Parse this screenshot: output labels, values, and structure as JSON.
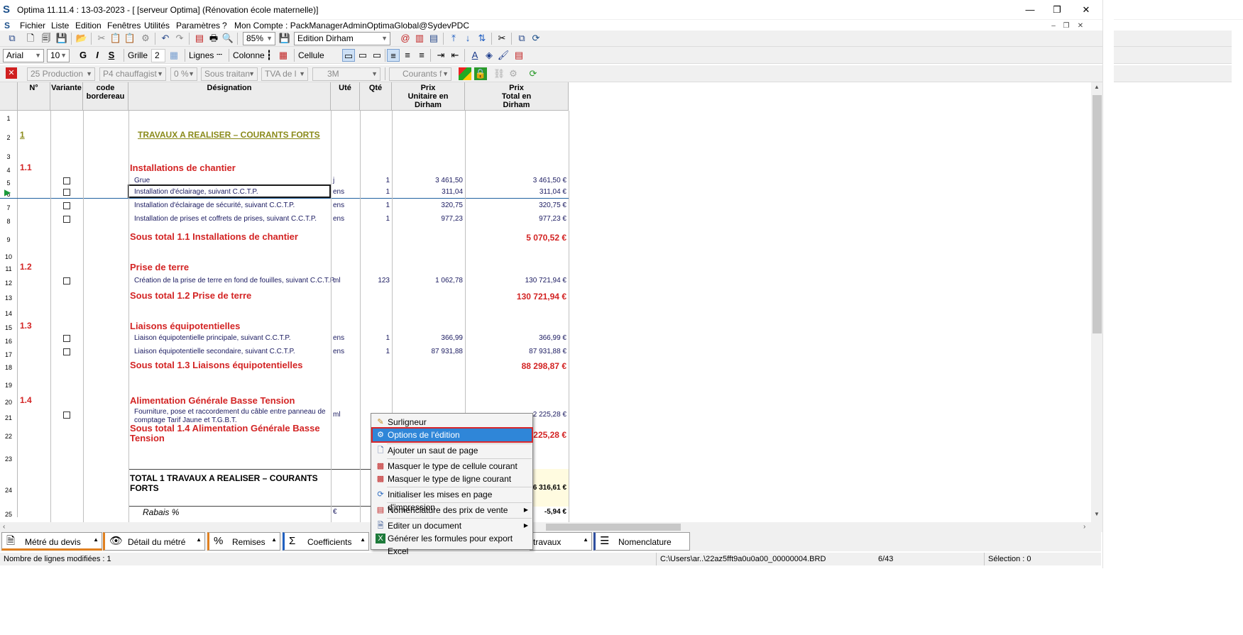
{
  "window": {
    "title": "Optima 11.11.4 : 13-03-2023 - [ [serveur Optima] (Rénovation école maternelle)]",
    "min": "—",
    "restore": "❐",
    "close": "✕"
  },
  "menu": [
    "Fichier",
    "Liste",
    "Edition",
    "Fenêtres",
    "Utilités",
    "Paramètres",
    "?",
    "Mon Compte : PackManagerAdminOptimaGlobal@SydevPDC"
  ],
  "toolbar1": {
    "zoom": "85%",
    "edition": "Edition Dirham"
  },
  "toolbar2": {
    "font": "Arial",
    "size": "10",
    "bold": "G",
    "italic": "I",
    "underline": "S",
    "grille_label": "Grille",
    "grille_value": "2",
    "lignes_label": "Lignes",
    "colonne_label": "Colonne",
    "cellule_label": "Cellule"
  },
  "toolbar3": {
    "production": "25  Production",
    "chauffage": "P4  chauffagist",
    "pct": "0 %",
    "sous_traitan": "Sous traitan",
    "tva": "TVA de l",
    "code3m": "3M",
    "courants": "Courants f"
  },
  "columns": {
    "no": "N°",
    "variante": "Variante",
    "code": "code bordereau",
    "designation": "Désignation",
    "ute": "Uté",
    "qte": "Qté",
    "pu": "Prix Unitaire en Dirham",
    "pt": "Prix Total en Dirham"
  },
  "rows": [
    {
      "n": "1"
    },
    {
      "n": "2",
      "no": "1",
      "title": "TRAVAUX A REALISER – COURANTS FORTS"
    },
    {
      "n": "3"
    },
    {
      "n": "4",
      "no": "1.1",
      "sec": "Installations de chantier"
    },
    {
      "n": "5",
      "desc": "Grue",
      "ute": "j",
      "qte": "1",
      "pu": "3 461,50",
      "pt": "3 461,50 €",
      "chk": true
    },
    {
      "n": "6",
      "desc": "Installation d'éclairage, suivant C.C.T.P.",
      "ute": "ens",
      "qte": "1",
      "pu": "311,04",
      "pt": "311,04 €",
      "chk": true
    },
    {
      "n": "7",
      "desc": "Installation d'éclairage de sécurité, suivant C.C.T.P.",
      "ute": "ens",
      "qte": "1",
      "pu": "320,75",
      "pt": "320,75 €",
      "chk": true
    },
    {
      "n": "8",
      "desc": "Installation de prises et coffrets de prises, suivant C.C.T.P.",
      "ute": "ens",
      "qte": "1",
      "pu": "977,23",
      "pt": "977,23 €",
      "chk": true
    },
    {
      "n": "9",
      "sub": "Sous total 1.1 Installations de chantier",
      "pt": "5 070,52 €"
    },
    {
      "n": "10"
    },
    {
      "n": "11",
      "no": "1.2",
      "sec": "Prise de terre"
    },
    {
      "n": "12",
      "desc": "Création de la prise de terre en fond de fouilles, suivant C.C.T.P.",
      "ute": "ml",
      "qte": "123",
      "pu": "1 062,78",
      "pt": "130 721,94 €",
      "chk": true
    },
    {
      "n": "13",
      "sub": "Sous total 1.2 Prise de terre",
      "pt": "130 721,94 €"
    },
    {
      "n": "14"
    },
    {
      "n": "15",
      "no": "1.3",
      "sec": "Liaisons équipotentielles"
    },
    {
      "n": "16",
      "desc": "Liaison équipotentielle principale, suivant C.C.T.P.",
      "ute": "ens",
      "qte": "1",
      "pu": "366,99",
      "pt": "366,99 €",
      "chk": true
    },
    {
      "n": "17",
      "desc": "Liaison équipotentielle secondaire, suivant C.C.T.P.",
      "ute": "ens",
      "qte": "1",
      "pu": "87 931,88",
      "pt": "87 931,88 €",
      "chk": true
    },
    {
      "n": "18",
      "sub": "Sous total 1.3 Liaisons équipotentielles",
      "pt": "88 298,87 €"
    },
    {
      "n": "19"
    },
    {
      "n": "20",
      "no": "1.4",
      "sec": "Alimentation Générale Basse Tension"
    },
    {
      "n": "21",
      "desc": "Fourniture, pose et raccordement du câble entre panneau de comptage Tarif Jaune et T.G.B.T.",
      "ute": "ml",
      "pt": "2 225,28 €",
      "chk": true
    },
    {
      "n": "22",
      "sub": "Sous total 1.4 Alimentation Générale Basse Tension",
      "pt": "225,28 €"
    },
    {
      "n": "23"
    },
    {
      "n": "24",
      "total": "TOTAL 1 TRAVAUX A REALISER – COURANTS FORTS",
      "pt": "6 316,61 €"
    },
    {
      "n": "25",
      "rabais": "Rabais %",
      "ute": "€",
      "pt": "-5,94 €"
    }
  ],
  "context_menu": [
    {
      "label": "Surligneur",
      "icon": "highlighter-icon"
    },
    {
      "label": "Options de l'édition",
      "icon": "options-icon",
      "highlighted": true
    },
    {
      "label": "Ajouter un saut de page",
      "icon": "page-break-icon"
    },
    {
      "label": "Masquer le type de cellule courant",
      "icon": "hide-cell-icon"
    },
    {
      "label": "Masquer le type de ligne courant",
      "icon": "hide-line-icon"
    },
    {
      "label": "Initialiser les mises en page d'impression",
      "icon": "refresh-icon"
    },
    {
      "label": "Nomenclature des prix de vente",
      "icon": "nomenclature-icon",
      "submenu": true
    },
    {
      "label": "Editer un document",
      "icon": "edit-doc-icon",
      "submenu": true
    },
    {
      "label": "Générer les formules pour export Excel",
      "icon": "excel-icon"
    }
  ],
  "tabs": [
    "Métré du devis",
    "Détail du métré",
    "Remises",
    "Coefficients",
    "travaux",
    "Nomenclature"
  ],
  "status": {
    "modified": "Nombre de lignes modifiées : 1",
    "path": "C:\\Users\\ar..\\22az5fft9a0u0a00_00000004.BRD",
    "page": "6/43",
    "selection": "Sélection : 0"
  },
  "colors": {
    "section_red": "#d32424",
    "title_olive": "#8a8a1a",
    "highlight_blue": "#2f86d8",
    "highlight_border": "#d8262b"
  }
}
